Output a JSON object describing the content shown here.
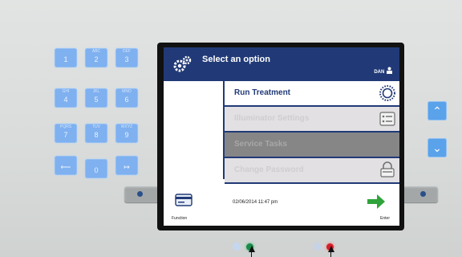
{
  "screen": {
    "title": "Select an option",
    "user": "DAN",
    "menu": [
      {
        "label": "Run Treatment",
        "icon": "sun-icon",
        "state": "enabled"
      },
      {
        "label": "Illuminator Settings",
        "icon": "settings-list-icon",
        "state": "disabled"
      },
      {
        "label": "Service Tasks",
        "icon": "",
        "state": "selected-disabled"
      },
      {
        "label": "Change Password",
        "icon": "lock-icon",
        "state": "disabled"
      }
    ],
    "datetime": "02/06/2014   11:47 pm",
    "function_label": "Function",
    "enter_label": "Enter"
  },
  "keypad": {
    "keys": [
      {
        "main": "1",
        "sub": ""
      },
      {
        "main": "2",
        "sub": "ABC"
      },
      {
        "main": "3",
        "sub": "DEF"
      },
      {
        "main": "4",
        "sub": "GHI"
      },
      {
        "main": "5",
        "sub": "JKL"
      },
      {
        "main": "6",
        "sub": "MNO"
      },
      {
        "main": "7",
        "sub": "PQRS"
      },
      {
        "main": "8",
        "sub": "TUV"
      },
      {
        "main": "9",
        "sub": "WXYZ"
      },
      {
        "main": "⟵",
        "sub": ""
      },
      {
        "main": "0",
        "sub": ""
      },
      {
        "main": "↦",
        "sub": ""
      }
    ],
    "up": "⌃",
    "down": "⌄"
  },
  "colors": {
    "header": "#213a77",
    "enter_arrow": "#2fa33a",
    "led_green": "#1d8a4a",
    "led_red": "#d41f2a"
  }
}
